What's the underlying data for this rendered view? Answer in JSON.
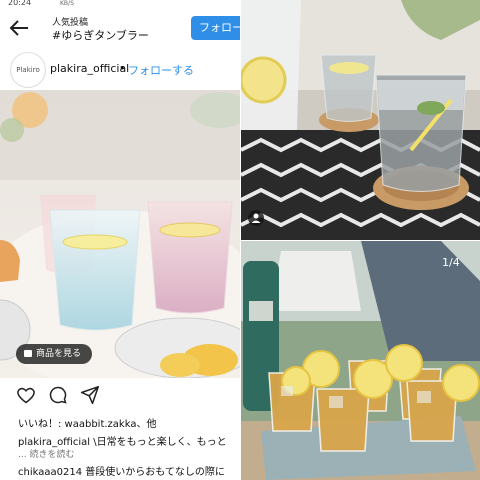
{
  "statusbar": {
    "time": "20:24",
    "network": "KB/S"
  },
  "header": {
    "subtitle": "人気投稿",
    "title": "#ゆらぎタンブラー",
    "follow_button": "フォロー"
  },
  "post": {
    "avatar_text": "Plakiro",
    "account": "plakira_official",
    "dot": "•",
    "follow_link": "フォローする",
    "shop_button": "商品を見る",
    "likes": "いいね！: waabbit.zakka、他",
    "caption_user": "plakira_official",
    "caption_text": " \\日常をもっと楽しく、もっと",
    "more": "... 続きを読む",
    "comment_user": "chikaaa0214",
    "comment_text": " 普段使いからおもてなしの際に"
  },
  "gallery": {
    "counter": "1/4"
  },
  "icons": [
    "back-arrow-icon",
    "heart-icon",
    "comment-icon",
    "share-icon",
    "bag-icon",
    "person-tag-icon"
  ],
  "colors": {
    "accent_blue": "#2f8fe8",
    "text": "#111111"
  }
}
